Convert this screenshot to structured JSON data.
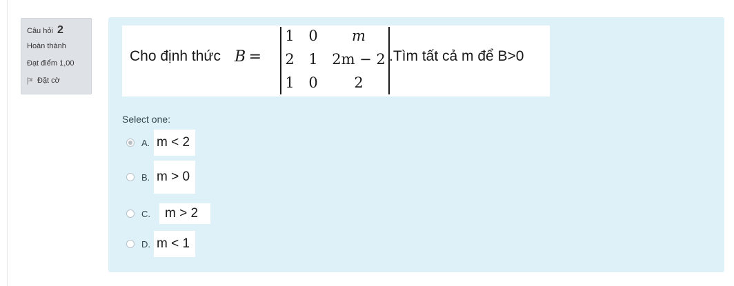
{
  "info": {
    "question_label": "Câu hỏi",
    "question_number": "2",
    "status": "Hoàn thành",
    "score": "Đạt điểm 1,00",
    "flag_label": "Đặt cờ"
  },
  "question": {
    "lead": "Cho định thức",
    "lhs_var": "B",
    "lhs_eq": "=",
    "matrix": [
      [
        "1",
        "0",
        "m"
      ],
      [
        "2",
        "1",
        "2m − 2"
      ],
      [
        "1",
        "0",
        "2"
      ]
    ],
    "tail": ".Tìm tất cả m để B>0"
  },
  "answer": {
    "prompt": "Select one:",
    "options": [
      {
        "label": "A.",
        "value": "m < 2",
        "checked": true
      },
      {
        "label": "B.",
        "value": "m > 0",
        "checked": false
      },
      {
        "label": "C.",
        "value": "m > 2",
        "checked": false
      },
      {
        "label": "D.",
        "value": "m < 1",
        "checked": false
      }
    ]
  },
  "colors": {
    "panel": "#def1f8",
    "info_box": "#dee2e6"
  }
}
